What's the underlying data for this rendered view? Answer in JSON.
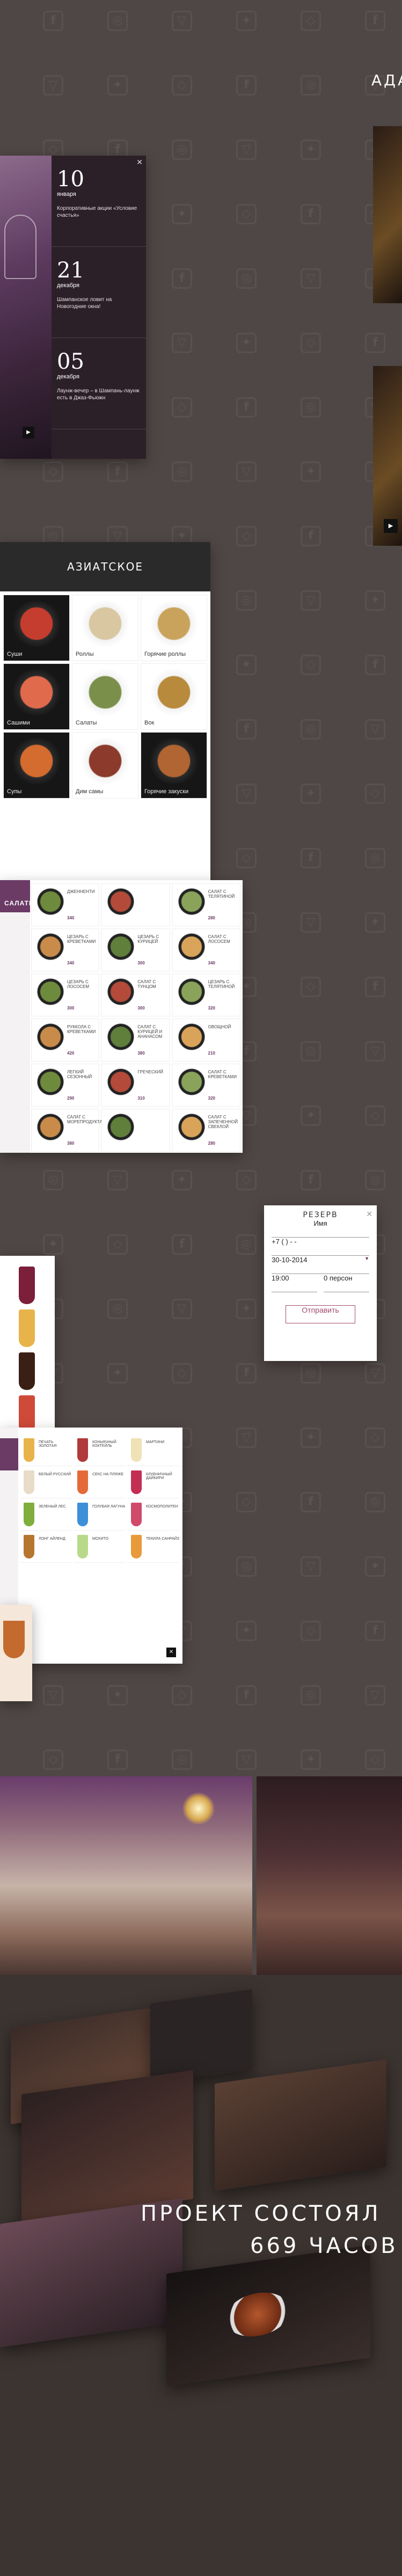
{
  "header": {
    "right_heading": "АДА"
  },
  "events": {
    "items": [
      {
        "day": "10",
        "month": "января",
        "desc": "Корпоративные акции «Условие счастья»"
      },
      {
        "day": "21",
        "month": "декабря",
        "desc": "Шампанское ловит на Новогодние окна!"
      },
      {
        "day": "05",
        "month": "декабря",
        "desc": "Лаунж-вечер – в Шампань-лаунж есть в Джаз-Фьюжн"
      }
    ],
    "close_icon": "close-icon",
    "play_icon": "play-icon"
  },
  "asian_menu": {
    "title": "АЗИАТСКОЕ",
    "tiles": [
      {
        "label": "Суши",
        "dark": true,
        "color": "#c43d2f"
      },
      {
        "label": "Роллы",
        "dark": false,
        "color": "#d8c7a1"
      },
      {
        "label": "Горячие роллы",
        "dark": false,
        "color": "#c9a35c"
      },
      {
        "label": "Сашими",
        "dark": true,
        "color": "#e06a4c"
      },
      {
        "label": "Салаты",
        "dark": false,
        "color": "#7a8f4a"
      },
      {
        "label": "Вок",
        "dark": false,
        "color": "#b78a3c"
      },
      {
        "label": "Супы",
        "dark": true,
        "color": "#d46b2f"
      },
      {
        "label": "Дим самы",
        "dark": false,
        "color": "#8b3a2b"
      },
      {
        "label": "Горячие закуски",
        "dark": true,
        "color": "#b06533"
      }
    ]
  },
  "salads_menu": {
    "category": "САЛАТЫ",
    "items": [
      {
        "title": "ДЖЕННЕНТИ",
        "price": "340"
      },
      {
        "title": "",
        "price": ""
      },
      {
        "title": "САЛАТ С ТЕЛЯТИНОЙ",
        "price": "280"
      },
      {
        "title": "ЦЕЗАРЬ С КРЕВЕТКАМИ",
        "price": "340"
      },
      {
        "title": "ЦЕЗАРЬ С КУРИЦЕЙ",
        "price": "300"
      },
      {
        "title": "САЛАТ С ЛОСОСЕМ",
        "price": "340"
      },
      {
        "title": "ЦЕЗАРЬ С ЛОСОСЕМ",
        "price": "300"
      },
      {
        "title": "САЛАТ С ТУНЦОМ",
        "price": "300"
      },
      {
        "title": "ЦЕЗАРЬ С ТЕЛЯТИНОЙ",
        "price": "320"
      },
      {
        "title": "РУККОЛА С КРЕВЕТКАМИ",
        "price": "420"
      },
      {
        "title": "САЛАТ С КУРИЦЕЙ И АНАНАСОМ",
        "price": "380"
      },
      {
        "title": "ОВОЩНОЙ",
        "price": "210"
      },
      {
        "title": "ЛЕГКИЙ СЕЗОННЫЙ",
        "price": "290"
      },
      {
        "title": "ГРЕЧЕСКИЙ",
        "price": "310"
      },
      {
        "title": "САЛАТ С КРЕВЕТКАМИ",
        "price": "320"
      },
      {
        "title": "САЛАТ С МОРЕПРОДУКТАМИ",
        "price": "380"
      },
      {
        "title": "",
        "price": ""
      },
      {
        "title": "САЛАТ С ЗАПЕЧЕННОЙ СВЕКЛОЙ",
        "price": "280"
      }
    ]
  },
  "reservation": {
    "title": "РЕЗЕРВ",
    "name_placeholder": "Имя",
    "phone": "+7  (       )        -      -",
    "date": "30-10-2014",
    "time": "19:00",
    "guests": "0 персон",
    "submit": "Отправить",
    "close_icon": "close-icon"
  },
  "drinks_menu": {
    "items": [
      {
        "name": "ПЕЧАТЬ ЗОЛОТАЯ",
        "color": "#e8b34a"
      },
      {
        "name": "КОНЬЯЧНЫЙ КОКТЕЙЛЬ",
        "color": "#b13a3a"
      },
      {
        "name": "МАРТИНИ",
        "color": "#f0e2b6"
      },
      {
        "name": "БЕЛЫЙ РУССКИЙ",
        "color": "#e8dcc8"
      },
      {
        "name": "СЕКС НА ПЛЯЖЕ",
        "color": "#e56a3a"
      },
      {
        "name": "КЛУБНИЧНЫЙ ДАЙКИРИ",
        "color": "#c42e52"
      },
      {
        "name": "ЗЕЛЕНЫЙ ЛЕС",
        "color": "#7fae3c"
      },
      {
        "name": "ГОЛУБАЯ ЛАГУНА",
        "color": "#3c8fd8"
      },
      {
        "name": "КОСМОПОЛИТЕН",
        "color": "#d04a6a"
      },
      {
        "name": "ЛОНГ АЙЛЕНД",
        "color": "#b7762f"
      },
      {
        "name": "МОХИТО",
        "color": "#b9d98a"
      },
      {
        "name": "ТЕКИЛА САНРАЙЗ",
        "color": "#e89a3a"
      }
    ]
  },
  "showcase": {
    "stat_line1": "ПРОЕКТ СОСТОЯЛ",
    "stat_line2": "669 ЧАСОВ"
  },
  "colors": {
    "background": "#4f4745",
    "accent": "#6b3b66",
    "button_border": "#a34b6e"
  }
}
